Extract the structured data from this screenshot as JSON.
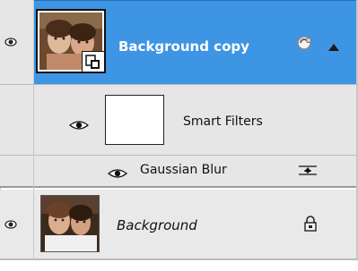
{
  "layers_panel": {
    "layers": [
      {
        "name": "Background copy",
        "selected": true,
        "visible": true,
        "type": "smart-object",
        "icons": [
          "eye-icon",
          "smart-object-badge-icon",
          "layer-effects-icon"
        ]
      },
      {
        "name": "Smart Filters",
        "visible": true,
        "type": "smart-filters-mask"
      },
      {
        "name": "Gaussian Blur",
        "visible": true,
        "type": "filter",
        "icons": [
          "eye-icon",
          "blending-options-icon"
        ]
      },
      {
        "name": "Background",
        "visible": true,
        "type": "locked-background",
        "icons": [
          "eye-icon",
          "lock-icon"
        ]
      }
    ]
  },
  "colors": {
    "selection": "#3e95e3",
    "row_bg": "#e6e6e6",
    "text_selected": "#ffffff",
    "text_normal": "#111111"
  }
}
